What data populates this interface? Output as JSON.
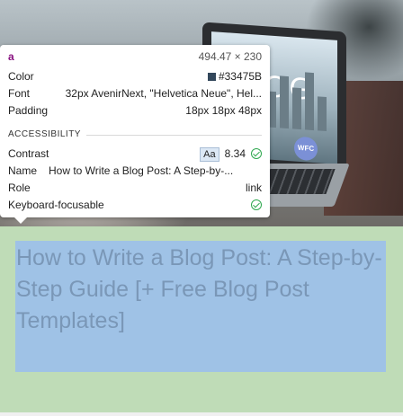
{
  "tooltip": {
    "tag": "a",
    "dimensions": "494.47 × 230",
    "color_label": "Color",
    "color_value": "#33475B",
    "color_swatch": "#33475b",
    "font_label": "Font",
    "font_value": "32px AvenirNext, \"Helvetica Neue\", Hel...",
    "padding_label": "Padding",
    "padding_value": "18px 18px 48px",
    "accessibility_heading": "ACCESSIBILITY",
    "contrast_label": "Contrast",
    "contrast_aa": "Aa",
    "contrast_value": "8.34",
    "name_label": "Name",
    "name_value": "How to Write a Blog Post: A Step-by-...",
    "role_label": "Role",
    "role_value": "link",
    "keyboard_label": "Keyboard-focusable",
    "check_icon": "check-circle-icon"
  },
  "laptop_screen": {
    "logo_text": "OG",
    "badge_text": "WFC"
  },
  "highlighted_link": {
    "text": "How to Write a Blog Post: A Step-by-Step Guide [+ Free Blog Post Templates]"
  },
  "colors": {
    "highlight_padding": "#bfdcb7",
    "highlight_content": "#9fc2e6",
    "link_text": "#7a97b7",
    "tag_color": "#881280",
    "check_green": "#2fa84f"
  }
}
